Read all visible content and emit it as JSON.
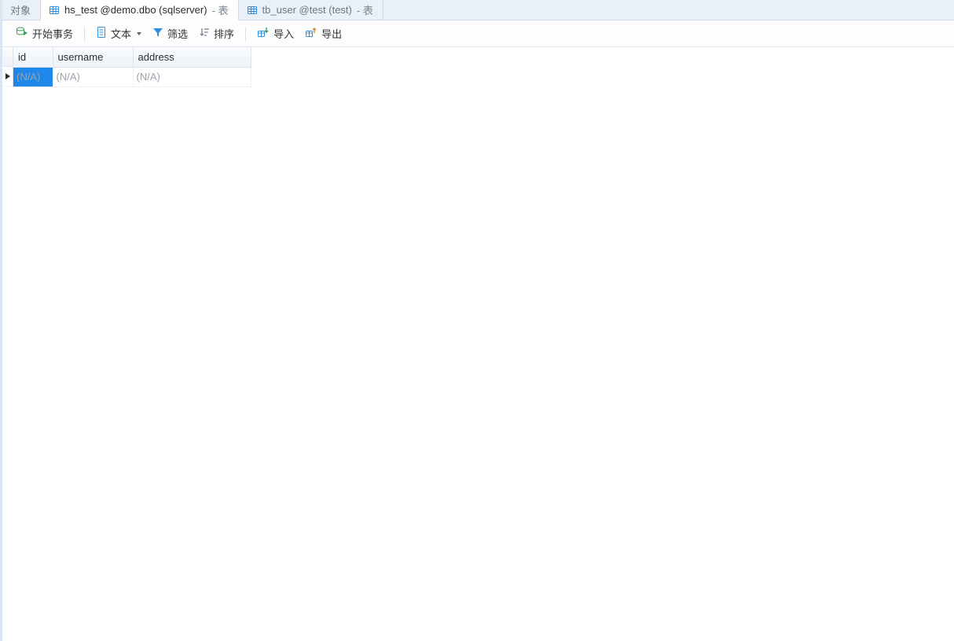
{
  "tabs": {
    "objects": {
      "label": "对象"
    },
    "active": {
      "label": "hs_test @demo.dbo (sqlserver)",
      "suffix": " - 表"
    },
    "inactive": {
      "label": "tb_user @test (test)",
      "suffix": " - 表"
    }
  },
  "toolbar": {
    "begin_transaction": "开始事务",
    "text_mode": "文本",
    "filter": "筛选",
    "sort": "排序",
    "import": "导入",
    "export": "导出"
  },
  "grid": {
    "columns": {
      "id": "id",
      "username": "username",
      "address": "address"
    },
    "na": "(N/A)"
  }
}
